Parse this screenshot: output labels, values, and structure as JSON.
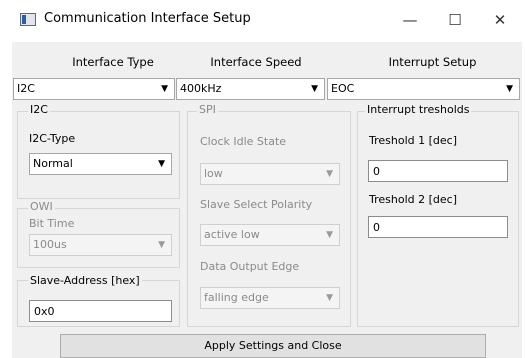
{
  "window": {
    "title": "Communication Interface Setup",
    "minimize_glyph": "—",
    "maximize_glyph": "☐",
    "close_glyph": "✕",
    "icon": "window-icon"
  },
  "headers": {
    "interface_type": "Interface Type",
    "interface_speed": "Interface Speed",
    "interrupt_setup": "Interrupt Setup"
  },
  "selects": {
    "interface_type": "I2C",
    "interface_speed": "400kHz",
    "interrupt_setup": "EOC"
  },
  "i2c": {
    "title": "I2C",
    "type_label": "I2C-Type",
    "type_value": "Normal"
  },
  "owi": {
    "title": "OWI",
    "bit_time_label": "Bit Time",
    "bit_time_value": "100us"
  },
  "slave": {
    "label": "Slave-Address [hex]",
    "value": "0x0"
  },
  "spi": {
    "title": "SPI",
    "clock_idle_label": "Clock Idle State",
    "clock_idle_value": "low",
    "ss_polarity_label": "Slave Select Polarity",
    "ss_polarity_value": "active low",
    "output_edge_label": "Data Output Edge",
    "output_edge_value": "falling edge"
  },
  "interrupt": {
    "title": "Interrupt tresholds",
    "t1_label": "Treshold 1 [dec]",
    "t1_value": "0",
    "t2_label": "Treshold 2 [dec]",
    "t2_value": "0"
  },
  "apply_button": "Apply Settings and Close",
  "icons": {
    "dropdown": "chevron-down-icon"
  },
  "colors": {
    "client_bg": "#f0f0f0",
    "disabled_text": "#8a8a8a",
    "group_border": "#d6d6d6"
  }
}
